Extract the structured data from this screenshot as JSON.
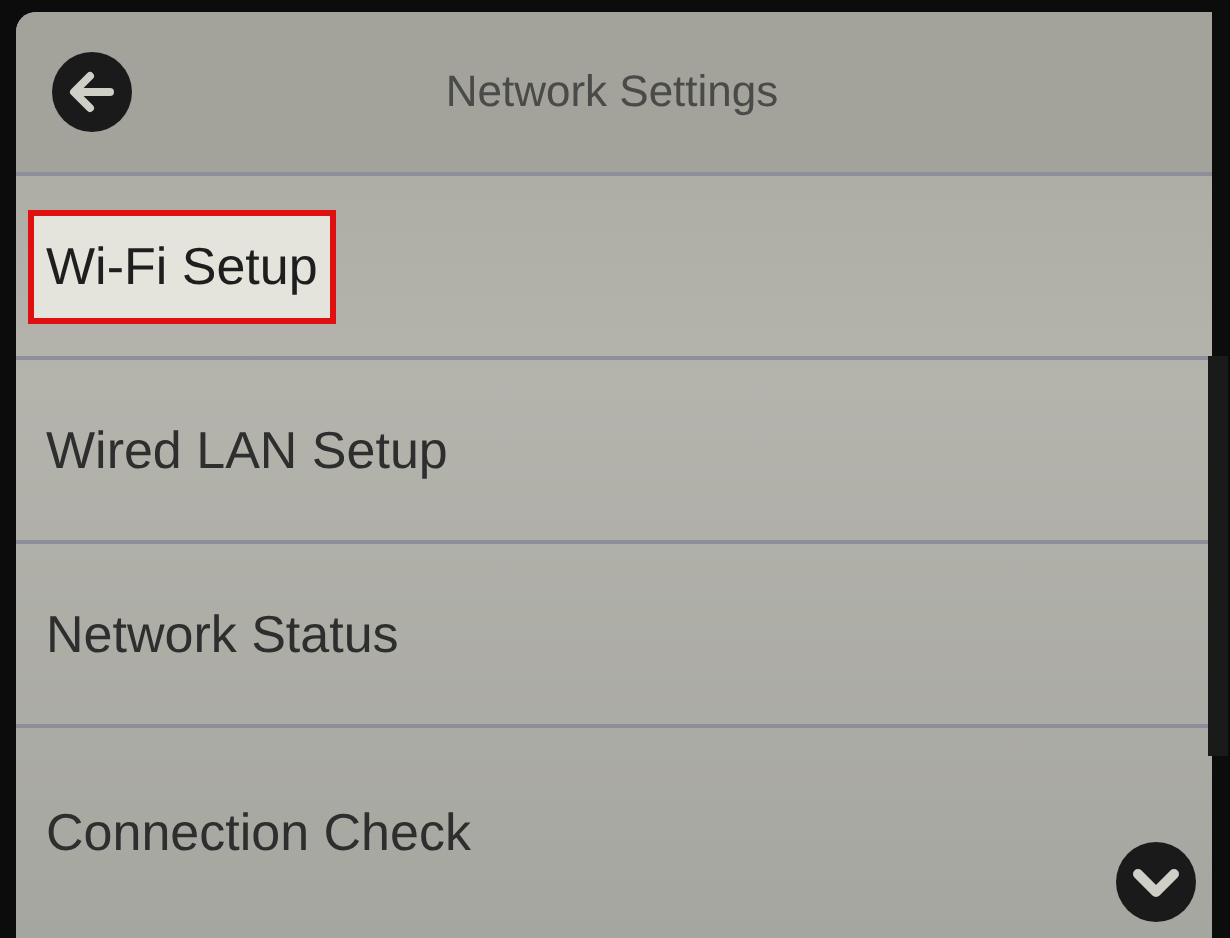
{
  "header": {
    "title": "Network Settings"
  },
  "menu_items": [
    {
      "label": "Wi-Fi Setup",
      "highlighted": true
    },
    {
      "label": "Wired LAN Setup",
      "highlighted": false
    },
    {
      "label": "Network Status",
      "highlighted": false
    },
    {
      "label": "Connection Check",
      "highlighted": false
    }
  ]
}
